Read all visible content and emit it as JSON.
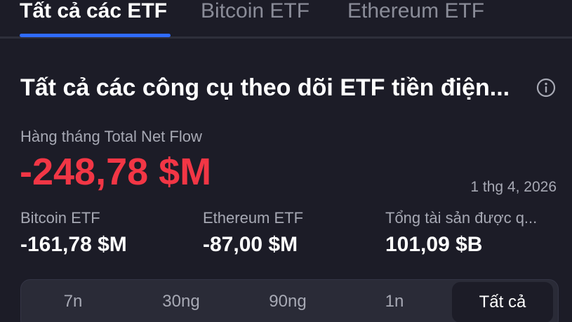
{
  "tabs": [
    {
      "label": "Tất cả các ETF",
      "active": true
    },
    {
      "label": "Bitcoin ETF",
      "active": false
    },
    {
      "label": "Ethereum ETF",
      "active": false
    }
  ],
  "card": {
    "title": "Tất cả các công cụ theo dõi ETF tiền điện...",
    "info_icon": "info-circle-icon"
  },
  "metric": {
    "label": "Hàng tháng Total Net Flow",
    "value": "-248,78 $M",
    "value_color": "#f23645",
    "date": "1 thg 4, 2026"
  },
  "sub_stats": [
    {
      "label": "Bitcoin ETF",
      "value": "-161,78 $M"
    },
    {
      "label": "Ethereum ETF",
      "value": "-87,00 $M"
    },
    {
      "label": "Tổng tài sản được q...",
      "value": "101,09 $B"
    }
  ],
  "range": {
    "options": [
      "7n",
      "30ng",
      "90ng",
      "1n",
      "Tất cả"
    ],
    "selected": "Tất cả"
  },
  "colors": {
    "background": "#1c1c27",
    "accent": "#2f6bff",
    "negative": "#f23645"
  }
}
